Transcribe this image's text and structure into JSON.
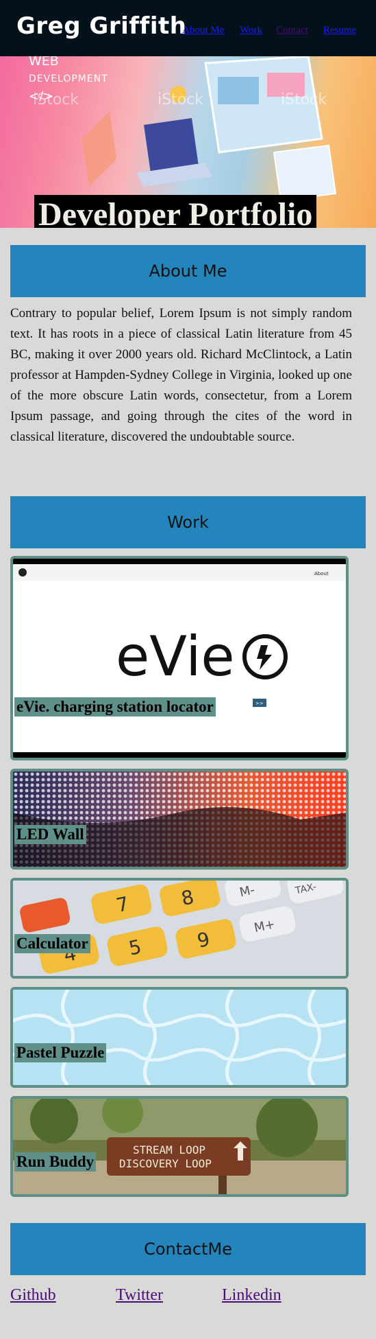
{
  "header": {
    "brand": "Greg Griffith",
    "nav": [
      {
        "label": "About Me",
        "visited": false
      },
      {
        "label": "Work",
        "visited": false
      },
      {
        "label": "Contact",
        "visited": true
      },
      {
        "label": "Resume",
        "visited": false
      }
    ]
  },
  "hero": {
    "title": "Developer Portfolio",
    "art_text": {
      "line1": "WEB",
      "line2": "DEVELOPMENT",
      "line3": "</>",
      "watermark": "iStock"
    }
  },
  "about": {
    "heading": "About Me",
    "body": "Contrary to popular belief, Lorem Ipsum is not simply random text. It has roots in a piece of classical Latin literature from 45 BC, making it over 2000 years old. Richard McClintock, a Latin professor at Hampden-Sydney College in Virginia, looked up one of the more obscure Latin words, consectetur, from a Lorem Ipsum passage, and going through the cites of the word in classical literature, discovered the undoubtable source."
  },
  "work": {
    "heading": "Work",
    "projects": [
      {
        "label": "eVie. charging station locator",
        "thumb_text": "eVie",
        "thumb_nav": "About",
        "button": ">>"
      },
      {
        "label": "LED Wall"
      },
      {
        "label": "Calculator",
        "thumb_keys": [
          "7",
          "8",
          "4",
          "5",
          "9",
          "M-",
          "M+",
          "TAX-"
        ]
      },
      {
        "label": "Pastel Puzzle"
      },
      {
        "label": "Run Buddy",
        "thumb_sign": [
          "STREAM LOOP",
          "DISCOVERY LOOP"
        ]
      }
    ]
  },
  "contact": {
    "heading": "ContactMe",
    "links": [
      "Github",
      "Twitter",
      "Linkedin"
    ]
  },
  "colors": {
    "header_bg": "#03111a",
    "section_bar": "#2385bb",
    "page_bg": "#d9dad7",
    "card_border": "#5e8f86",
    "label_bg": "#5f908a",
    "link_visited": "#4b0a7a",
    "link": "#1a1aff"
  }
}
